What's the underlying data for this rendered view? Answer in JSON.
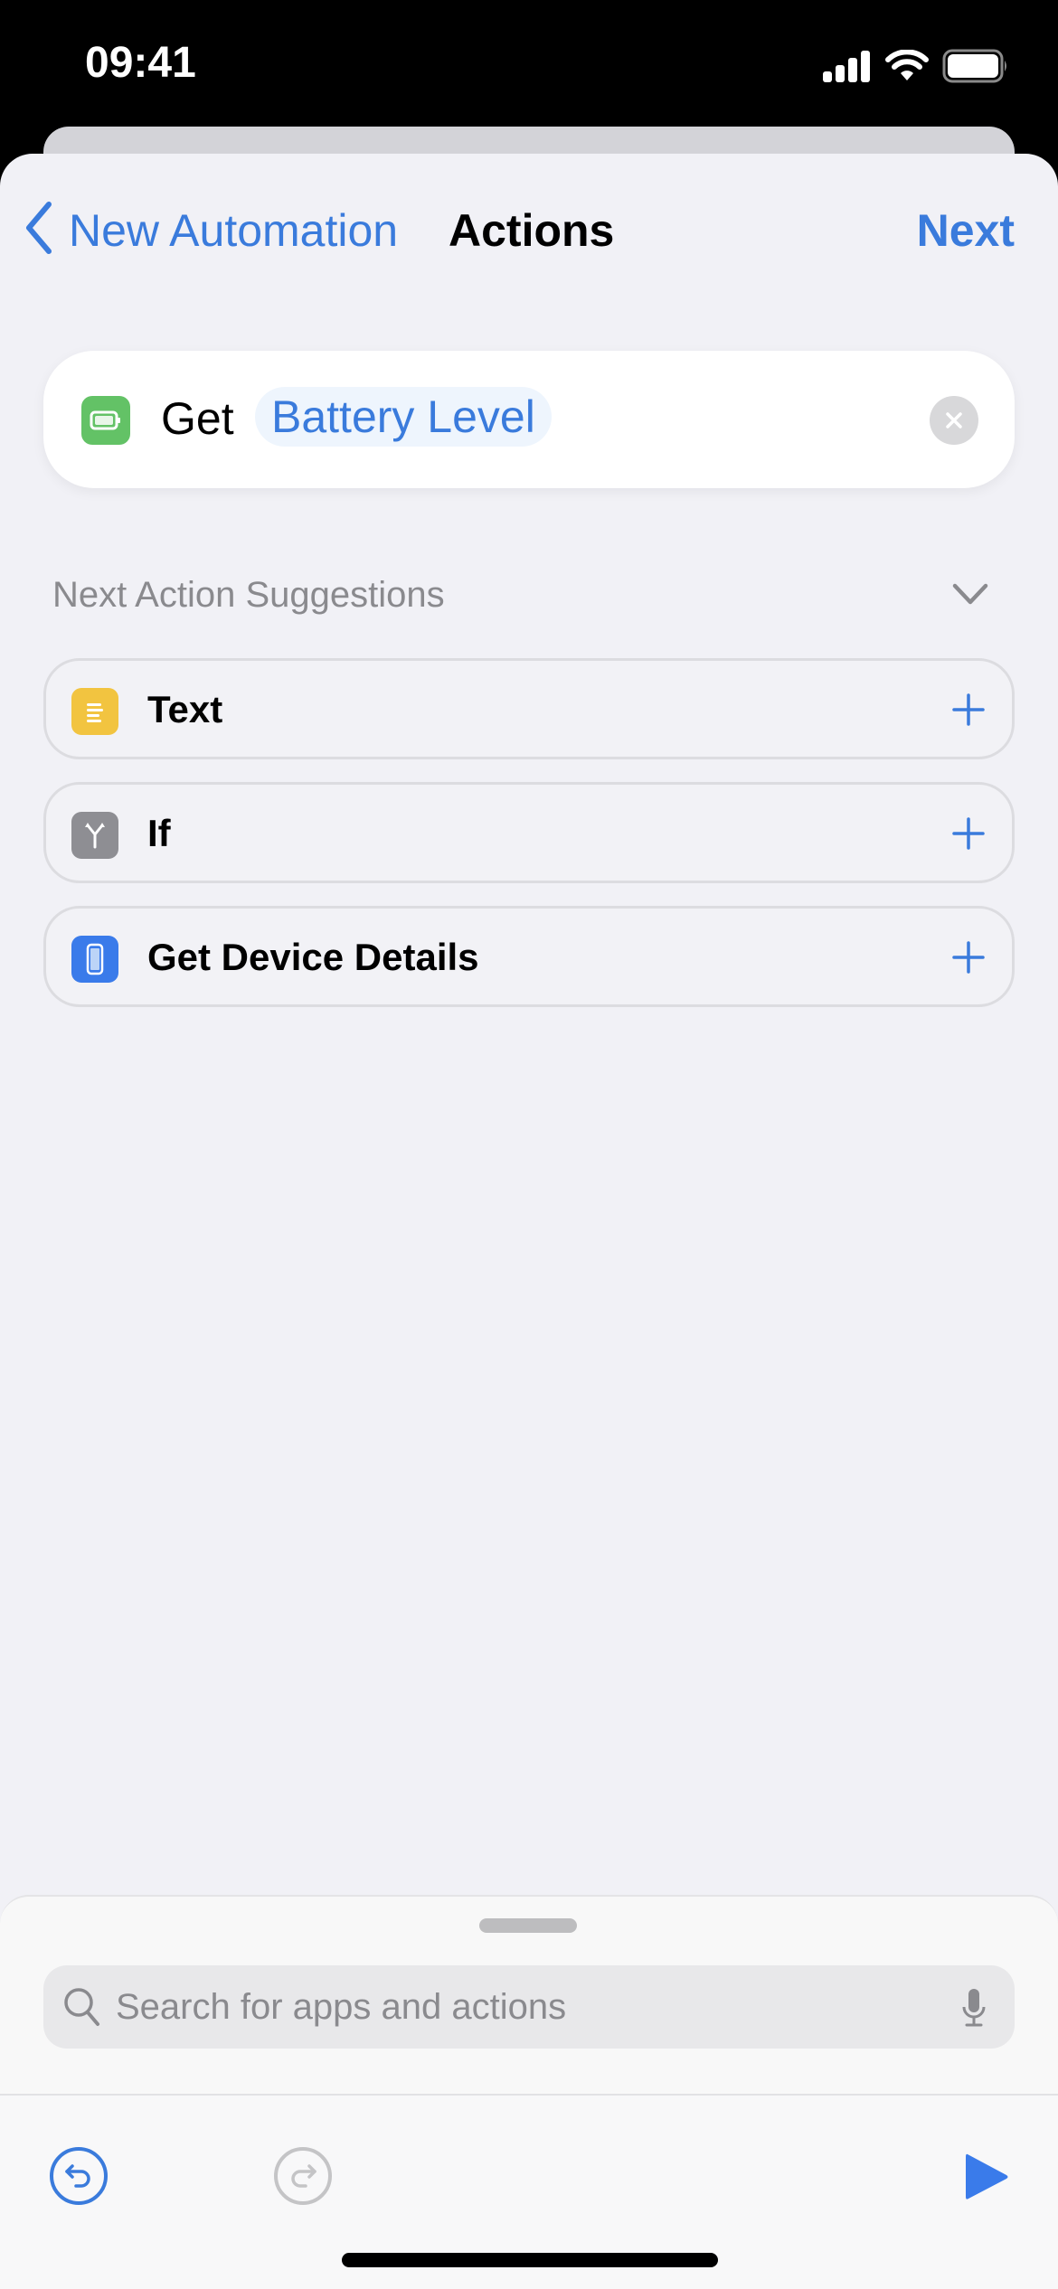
{
  "status_bar": {
    "time": "09:41",
    "icons": [
      "cellular-signal-icon",
      "wifi-icon",
      "battery-icon"
    ]
  },
  "nav": {
    "back_label": "New Automation",
    "back_icon": "chevron-left-icon",
    "title": "Actions",
    "next_label": "Next"
  },
  "action": {
    "icon": "battery-icon",
    "icon_color": "#63c266",
    "verb": "Get",
    "parameter": "Battery Level",
    "remove_icon": "clear-icon"
  },
  "suggestions": {
    "header": "Next Action Suggestions",
    "toggle_icon": "chevron-down-icon",
    "items": [
      {
        "label": "Text",
        "icon": "text-lines-icon",
        "icon_color": "#f2c440"
      },
      {
        "label": "If",
        "icon": "branch-icon",
        "icon_color": "#8e8e93"
      },
      {
        "label": "Get Device Details",
        "icon": "phone-device-icon",
        "icon_color": "#3a7bea"
      }
    ],
    "add_icon": "plus-icon"
  },
  "search": {
    "placeholder": "Search for apps and actions",
    "value": "",
    "search_icon": "magnifier-icon",
    "mic_icon": "microphone-icon"
  },
  "toolbar": {
    "undo_icon": "undo-icon",
    "redo_icon": "redo-icon",
    "run_icon": "play-icon"
  },
  "colors": {
    "accent": "#3a7bdc",
    "background": "#f1f1f6",
    "secondary_text": "#8a8a8e"
  }
}
